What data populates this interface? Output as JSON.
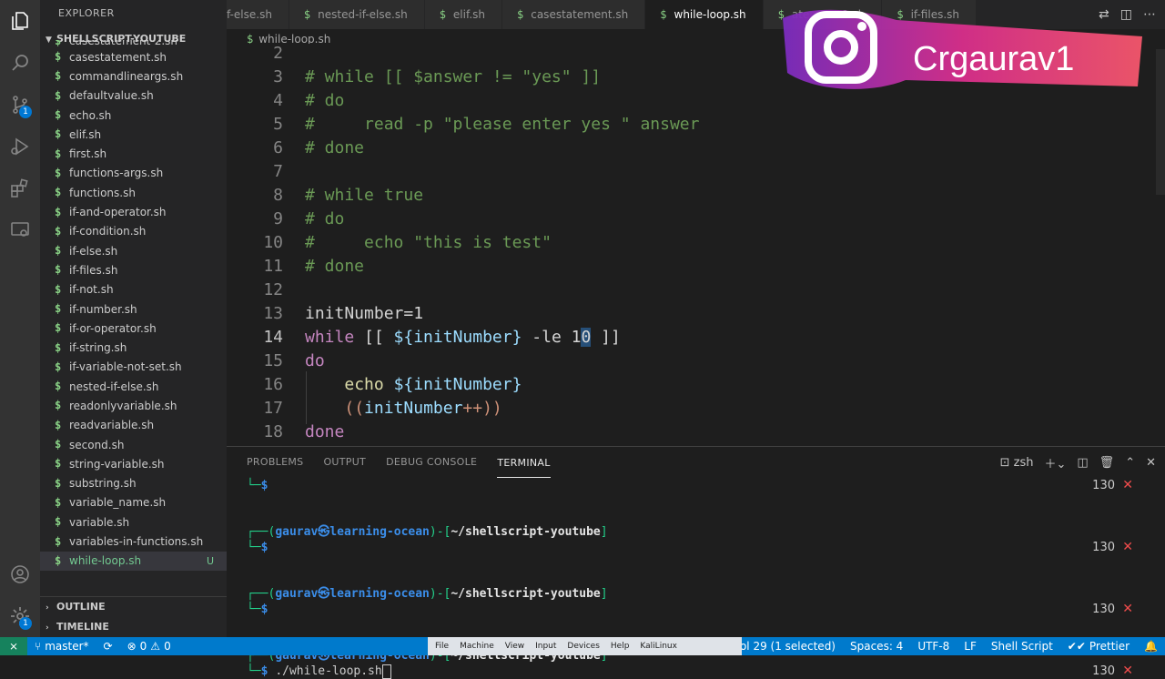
{
  "sidebar": {
    "title": "EXPLORER",
    "folder": "SHELLSCRIPT-YOUTUBE",
    "files": [
      "casestatement-2.sh",
      "casestatement.sh",
      "commandlineargs.sh",
      "defaultvalue.sh",
      "echo.sh",
      "elif.sh",
      "first.sh",
      "functions-args.sh",
      "functions.sh",
      "if-and-operator.sh",
      "if-condition.sh",
      "if-else.sh",
      "if-files.sh",
      "if-not.sh",
      "if-number.sh",
      "if-or-operator.sh",
      "if-string.sh",
      "if-variable-not-set.sh",
      "nested-if-else.sh",
      "readonlyvariable.sh",
      "readvariable.sh",
      "second.sh",
      "string-variable.sh",
      "substring.sh",
      "variable_name.sh",
      "variable.sh",
      "variables-in-functions.sh",
      "while-loop.sh"
    ],
    "active_git_status": "U",
    "outline": "OUTLINE",
    "timeline": "TIMELINE"
  },
  "activity": {
    "scm_badge": "1",
    "account_badge": "1"
  },
  "tabs": [
    "f-else.sh",
    "nested-if-else.sh",
    "elif.sh",
    "casestatement.sh",
    "while-loop.sh",
    "atement-2.sh",
    "if-files.sh"
  ],
  "breadcrumb": "while-loop.sh",
  "editor": {
    "line_numbers": [
      "2",
      "3",
      "4",
      "5",
      "6",
      "7",
      "8",
      "9",
      "10",
      "11",
      "12",
      "13",
      "14",
      "15",
      "16",
      "17",
      "18"
    ],
    "lines": [
      "",
      "# while [[ $answer != \"yes\" ]]",
      "# do",
      "#     read -p \"please enter yes \" answer",
      "# done",
      "",
      "# while true",
      "# do",
      "#     echo \"this is test\"",
      "# done",
      "",
      "initNumber=1",
      "",
      "do",
      "",
      "",
      "done"
    ],
    "l14": {
      "kw": "while",
      "p1": " [[ ",
      "var": "${initNumber}",
      "p2": " -le 1",
      "sel": "0",
      "p3": " ]]"
    },
    "l16": {
      "fn": "echo",
      "var": "${initNumber}"
    },
    "l17": {
      "open": "((",
      "var": "initNumber",
      "close": "++))"
    }
  },
  "panel": {
    "tabs": [
      "PROBLEMS",
      "OUTPUT",
      "DEBUG CONSOLE",
      "TERMINAL"
    ],
    "shell": "zsh",
    "prompt": {
      "user": "gaurav",
      "at": "㉿",
      "host": "learning-ocean",
      "path": "~/shellscript-youtube"
    },
    "exit_code": "130",
    "command": "./while-loop.sh"
  },
  "status": {
    "branch": "master*",
    "errors": "0",
    "warnings": "0",
    "position": "14, Col 29 (1 selected)",
    "spaces": "Spaces: 4",
    "encoding": "UTF-8",
    "eol": "LF",
    "language": "Shell Script",
    "formatter": "Prettier"
  },
  "vbox_menu": [
    "File",
    "Machine",
    "View",
    "Input",
    "Devices",
    "Help",
    "KaliLinux"
  ],
  "watermark": {
    "text": "Crgaurav1",
    "colors": {
      "pink": "#d92f8c",
      "purple": "#7b2cbf",
      "gradient_end": "#f5576c"
    }
  }
}
